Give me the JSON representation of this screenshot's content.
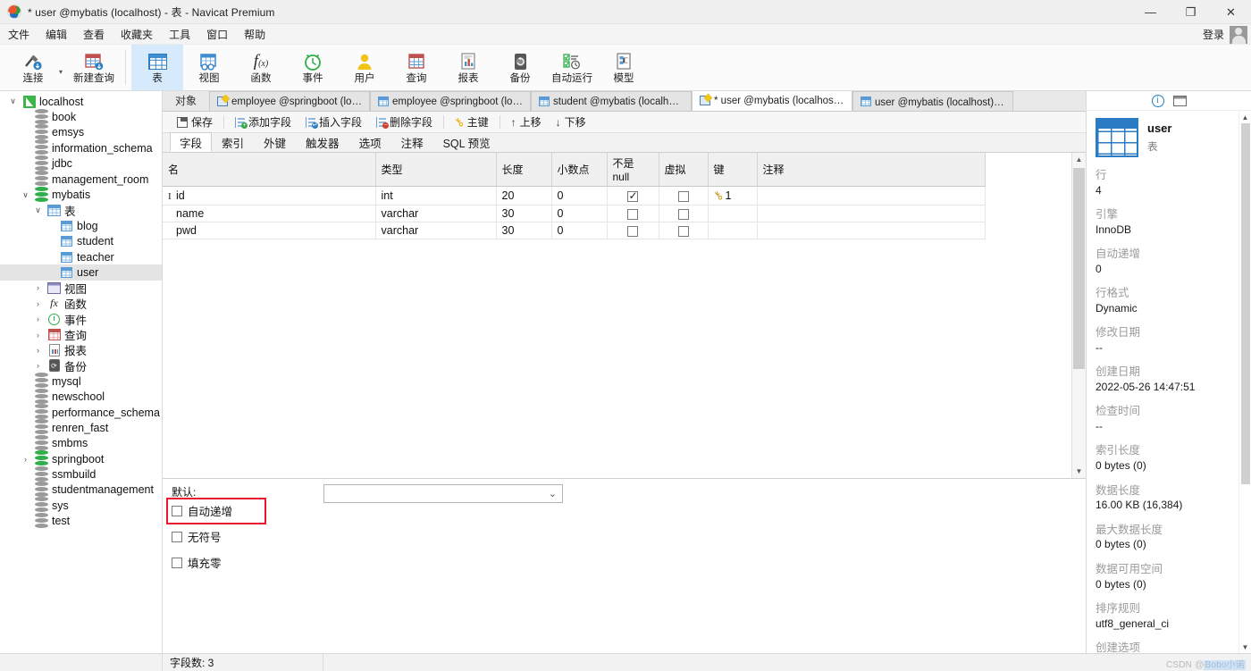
{
  "window": {
    "title": "* user @mybatis (localhost) - 表 - Navicat Premium",
    "minimize": "—",
    "maximize": "❐",
    "close": "✕"
  },
  "menubar": {
    "items": [
      {
        "label": "文件"
      },
      {
        "label": "编辑"
      },
      {
        "label": "查看"
      },
      {
        "label": "收藏夹"
      },
      {
        "label": "工具"
      },
      {
        "label": "窗口"
      },
      {
        "label": "帮助"
      }
    ],
    "login_label": "登录"
  },
  "toolbar": {
    "buttons": [
      {
        "label": "连接",
        "icon": "connection-icon",
        "active": false
      },
      {
        "label": "新建查询",
        "icon": "new-query-icon",
        "active": false
      },
      {
        "label": "表",
        "icon": "table-icon",
        "active": true
      },
      {
        "label": "视图",
        "icon": "view-icon",
        "active": false
      },
      {
        "label": "函数",
        "icon": "function-icon",
        "active": false
      },
      {
        "label": "事件",
        "icon": "event-icon",
        "active": false
      },
      {
        "label": "用户",
        "icon": "user-icon",
        "active": false
      },
      {
        "label": "查询",
        "icon": "query-icon",
        "active": false
      },
      {
        "label": "报表",
        "icon": "report-icon",
        "active": false
      },
      {
        "label": "备份",
        "icon": "backup-icon",
        "active": false
      },
      {
        "label": "自动运行",
        "icon": "automation-icon",
        "active": false
      },
      {
        "label": "模型",
        "icon": "model-icon",
        "active": false
      }
    ]
  },
  "sidebar": {
    "items": [
      {
        "label": "localhost",
        "indent": 0,
        "twisty": "∨",
        "icon": "server-icon",
        "selected": false
      },
      {
        "label": "book",
        "indent": 1,
        "twisty": "",
        "icon": "database-icon",
        "selected": false
      },
      {
        "label": "emsys",
        "indent": 1,
        "twisty": "",
        "icon": "database-icon",
        "selected": false
      },
      {
        "label": "information_schema",
        "indent": 1,
        "twisty": "",
        "icon": "database-icon",
        "selected": false
      },
      {
        "label": "jdbc",
        "indent": 1,
        "twisty": "",
        "icon": "database-icon",
        "selected": false
      },
      {
        "label": "management_room",
        "indent": 1,
        "twisty": "",
        "icon": "database-icon",
        "selected": false
      },
      {
        "label": "mybatis",
        "indent": 1,
        "twisty": "∨",
        "icon": "database-open-icon",
        "selected": false
      },
      {
        "label": "表",
        "indent": 2,
        "twisty": "∨",
        "icon": "tables-folder-icon",
        "selected": false
      },
      {
        "label": "blog",
        "indent": 3,
        "twisty": "",
        "icon": "table-icon",
        "selected": false
      },
      {
        "label": "student",
        "indent": 3,
        "twisty": "",
        "icon": "table-icon",
        "selected": false
      },
      {
        "label": "teacher",
        "indent": 3,
        "twisty": "",
        "icon": "table-icon",
        "selected": false
      },
      {
        "label": "user",
        "indent": 3,
        "twisty": "",
        "icon": "table-icon",
        "selected": true
      },
      {
        "label": "视图",
        "indent": 2,
        "twisty": "›",
        "icon": "views-folder-icon",
        "selected": false
      },
      {
        "label": "函数",
        "indent": 2,
        "twisty": "›",
        "icon": "functions-folder-icon",
        "selected": false
      },
      {
        "label": "事件",
        "indent": 2,
        "twisty": "›",
        "icon": "events-folder-icon",
        "selected": false
      },
      {
        "label": "查询",
        "indent": 2,
        "twisty": "›",
        "icon": "queries-folder-icon",
        "selected": false
      },
      {
        "label": "报表",
        "indent": 2,
        "twisty": "›",
        "icon": "reports-folder-icon",
        "selected": false
      },
      {
        "label": "备份",
        "indent": 2,
        "twisty": "›",
        "icon": "backups-folder-icon",
        "selected": false
      },
      {
        "label": "mysql",
        "indent": 1,
        "twisty": "",
        "icon": "database-icon",
        "selected": false
      },
      {
        "label": "newschool",
        "indent": 1,
        "twisty": "",
        "icon": "database-icon",
        "selected": false
      },
      {
        "label": "performance_schema",
        "indent": 1,
        "twisty": "",
        "icon": "database-icon",
        "selected": false
      },
      {
        "label": "renren_fast",
        "indent": 1,
        "twisty": "",
        "icon": "database-icon",
        "selected": false
      },
      {
        "label": "smbms",
        "indent": 1,
        "twisty": "",
        "icon": "database-icon",
        "selected": false
      },
      {
        "label": "springboot",
        "indent": 1,
        "twisty": "›",
        "icon": "database-open-icon",
        "selected": false
      },
      {
        "label": "ssmbuild",
        "indent": 1,
        "twisty": "",
        "icon": "database-icon",
        "selected": false
      },
      {
        "label": "studentmanagement",
        "indent": 1,
        "twisty": "",
        "icon": "database-icon",
        "selected": false
      },
      {
        "label": "sys",
        "indent": 1,
        "twisty": "",
        "icon": "database-icon",
        "selected": false
      },
      {
        "label": "test",
        "indent": 1,
        "twisty": "",
        "icon": "database-icon",
        "selected": false
      }
    ]
  },
  "tabstrip": {
    "object_label": "对象",
    "tabs": [
      {
        "label": "employee @springboot (loc...",
        "icon": "design-icon",
        "active": false
      },
      {
        "label": "employee @springboot (loc...",
        "icon": "table-icon",
        "active": false
      },
      {
        "label": "student @mybatis (localhos...",
        "icon": "table-icon",
        "active": false
      },
      {
        "label": "* user @mybatis (localhost) ...",
        "icon": "design-icon",
        "active": true
      },
      {
        "label": "user @mybatis (localhost) - 表",
        "icon": "table-icon",
        "active": false
      }
    ]
  },
  "designer_toolbar": {
    "buttons": [
      {
        "label": "保存",
        "icon": "save-icon"
      },
      {
        "label": "添加字段",
        "icon": "add-field-icon"
      },
      {
        "label": "插入字段",
        "icon": "insert-field-icon"
      },
      {
        "label": "删除字段",
        "icon": "delete-field-icon"
      },
      {
        "label": "主键",
        "icon": "primary-key-icon"
      },
      {
        "label": "上移",
        "icon": "move-up-icon"
      },
      {
        "label": "下移",
        "icon": "move-down-icon"
      }
    ]
  },
  "subtabs": {
    "items": [
      {
        "label": "字段",
        "active": true
      },
      {
        "label": "索引",
        "active": false
      },
      {
        "label": "外键",
        "active": false
      },
      {
        "label": "触发器",
        "active": false
      },
      {
        "label": "选项",
        "active": false
      },
      {
        "label": "注释",
        "active": false
      },
      {
        "label": "SQL 预览",
        "active": false
      }
    ]
  },
  "grid": {
    "columns": [
      "名",
      "类型",
      "长度",
      "小数点",
      "不是 null",
      "虚拟",
      "键",
      "注释"
    ],
    "rows": [
      {
        "name": "id",
        "type": "int",
        "length": "20",
        "decimals": "0",
        "not_null": true,
        "virtual": false,
        "key": "1",
        "comment": "",
        "current": true
      },
      {
        "name": "name",
        "type": "varchar",
        "length": "30",
        "decimals": "0",
        "not_null": false,
        "virtual": false,
        "key": "",
        "comment": "",
        "current": false
      },
      {
        "name": "pwd",
        "type": "varchar",
        "length": "30",
        "decimals": "0",
        "not_null": false,
        "virtual": false,
        "key": "",
        "comment": "",
        "current": false
      }
    ]
  },
  "field_props": {
    "default_label": "默认:",
    "default_value": "",
    "checkboxes": [
      {
        "label": "自动递增",
        "checked": false,
        "highlighted": true
      },
      {
        "label": "无符号",
        "checked": false,
        "highlighted": false
      },
      {
        "label": "填充零",
        "checked": false,
        "highlighted": false
      }
    ]
  },
  "info_panel": {
    "tab_info_icon": "info-icon",
    "tab_ddl_icon": "ddl-icon",
    "object_name": "user",
    "object_type": "表",
    "properties": [
      {
        "key": "行",
        "value": "4"
      },
      {
        "key": "引擎",
        "value": "InnoDB"
      },
      {
        "key": "自动递增",
        "value": "0"
      },
      {
        "key": "行格式",
        "value": "Dynamic"
      },
      {
        "key": "修改日期",
        "value": "--"
      },
      {
        "key": "创建日期",
        "value": "2022-05-26 14:47:51"
      },
      {
        "key": "检查时间",
        "value": "--"
      },
      {
        "key": "索引长度",
        "value": "0 bytes (0)"
      },
      {
        "key": "数据长度",
        "value": "16.00 KB (16,384)"
      },
      {
        "key": "最大数据长度",
        "value": "0 bytes (0)"
      },
      {
        "key": "数据可用空间",
        "value": "0 bytes (0)"
      },
      {
        "key": "排序规则",
        "value": "utf8_general_ci"
      },
      {
        "key": "创建选项",
        "value": ""
      }
    ]
  },
  "statusbar": {
    "field_count": "字段数: 3",
    "watermark_prefix": "CSDN @",
    "watermark_name": "Bobo小诺"
  },
  "colors": {
    "accent_blue": "#2b7cc4",
    "active_tab_bg": "#d6eafc",
    "highlight_red": "#e8192c",
    "selection_gray": "#e4e4e4",
    "db_green": "#2fae4a"
  }
}
